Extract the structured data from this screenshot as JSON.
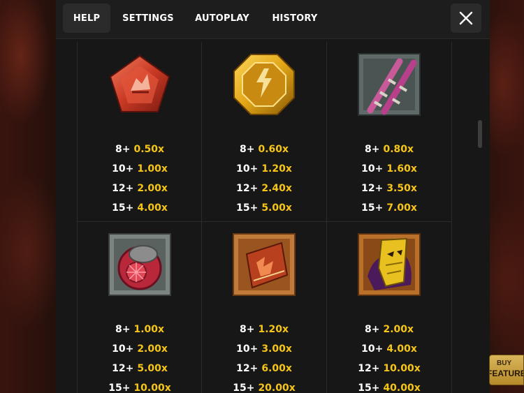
{
  "tabs": [
    {
      "label": "HELP",
      "active": true
    },
    {
      "label": "SETTINGS",
      "active": false
    },
    {
      "label": "AUTOPLAY",
      "active": false
    },
    {
      "label": "HISTORY",
      "active": false
    }
  ],
  "close_icon": "close-icon",
  "symbols": [
    {
      "icon": "red-pentagon-gem-icon",
      "pays": [
        {
          "count": "8+",
          "multiplier": "0.50x"
        },
        {
          "count": "10+",
          "multiplier": "1.00x"
        },
        {
          "count": "12+",
          "multiplier": "2.00x"
        },
        {
          "count": "15+",
          "multiplier": "4.00x"
        }
      ]
    },
    {
      "icon": "gold-octagon-emblem-icon",
      "pays": [
        {
          "count": "8+",
          "multiplier": "0.60x"
        },
        {
          "count": "10+",
          "multiplier": "1.20x"
        },
        {
          "count": "12+",
          "multiplier": "2.40x"
        },
        {
          "count": "15+",
          "multiplier": "5.00x"
        }
      ]
    },
    {
      "icon": "crossed-staffs-icon",
      "pays": [
        {
          "count": "8+",
          "multiplier": "0.80x"
        },
        {
          "count": "10+",
          "multiplier": "1.60x"
        },
        {
          "count": "12+",
          "multiplier": "3.50x"
        },
        {
          "count": "15+",
          "multiplier": "7.00x"
        }
      ]
    },
    {
      "icon": "red-ring-icon",
      "pays": [
        {
          "count": "8+",
          "multiplier": "1.00x"
        },
        {
          "count": "10+",
          "multiplier": "2.00x"
        },
        {
          "count": "12+",
          "multiplier": "5.00x"
        },
        {
          "count": "15+",
          "multiplier": "10.00x"
        }
      ]
    },
    {
      "icon": "spellbook-icon",
      "pays": [
        {
          "count": "8+",
          "multiplier": "1.20x"
        },
        {
          "count": "10+",
          "multiplier": "3.00x"
        },
        {
          "count": "12+",
          "multiplier": "6.00x"
        },
        {
          "count": "15+",
          "multiplier": "20.00x"
        }
      ]
    },
    {
      "icon": "golden-mask-icon",
      "pays": [
        {
          "count": "8+",
          "multiplier": "2.00x"
        },
        {
          "count": "10+",
          "multiplier": "4.00x"
        },
        {
          "count": "12+",
          "multiplier": "10.00x"
        },
        {
          "count": "15+",
          "multiplier": "40.00x"
        }
      ]
    }
  ],
  "buy_feature": {
    "line1": "BUY",
    "line2": "FEATURE"
  },
  "colors": {
    "multiplier": "#f5c518",
    "panel": "#171717",
    "tab_active": "#2b2b2b"
  }
}
